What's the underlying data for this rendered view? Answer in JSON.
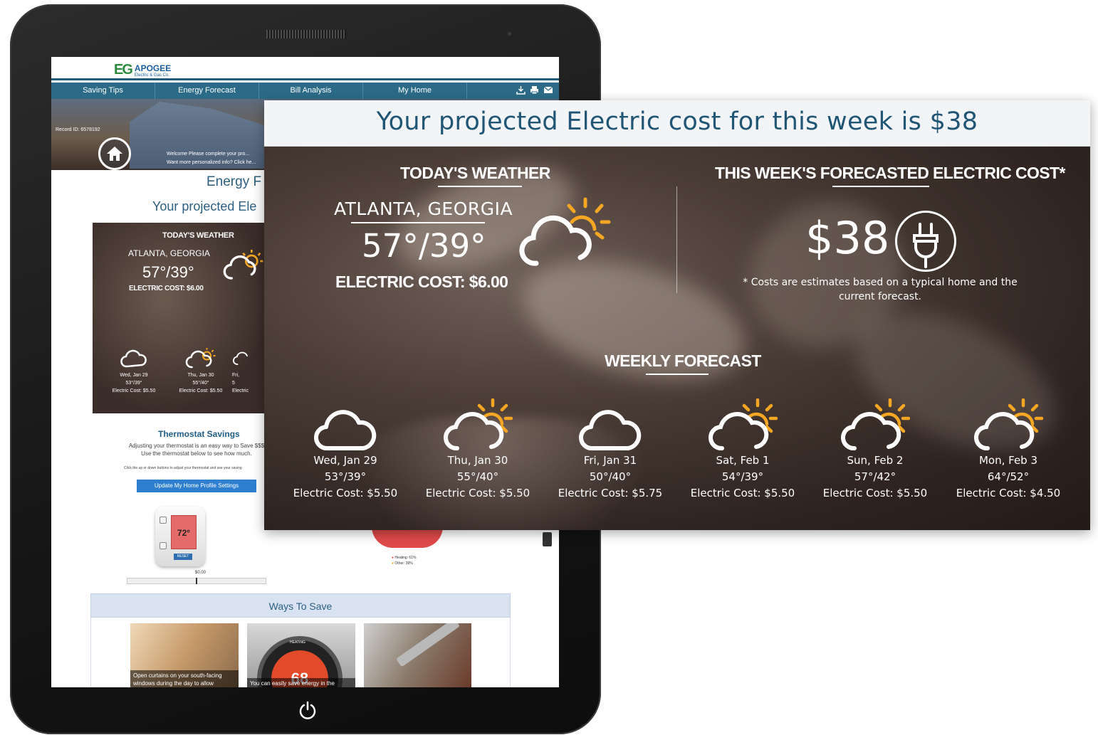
{
  "app": {
    "logo_mark": "EG",
    "logo_name": "APOGEE",
    "logo_sub": "Electric & Gas Co.",
    "nav": [
      "Saving Tips",
      "Energy Forecast",
      "Bill Analysis",
      "My Home"
    ],
    "record_id": "Record ID: 6578192",
    "welcome_line1": "Welcome Please complete your pro...",
    "welcome_line2": "Want more personalized info? Click he...",
    "energy_title": "Energy F",
    "projected_small": "Your projected Ele",
    "mini": {
      "today_heading": "TODAY'S WEATHER",
      "city": "ATLANTA, GEORGIA",
      "temp": "57°/39°",
      "cost": "ELECTRIC COST: $6.00",
      "days": [
        {
          "date": "Wed, Jan 29",
          "temp": "53°/39°",
          "cost": "Electric Cost: $5.50"
        },
        {
          "date": "Thu, Jan 30",
          "temp": "55°/40°",
          "cost": "Electric Cost: $5.50"
        },
        {
          "date": "Fri,",
          "temp": "5",
          "cost": "Electric"
        }
      ]
    },
    "thermostat": {
      "title": "Thermostat Savings",
      "text1": "Adjusting your thermostat is an easy way to Save $$$",
      "text2": "Use the thermostat below to see how much.",
      "hint": "Click the up or down buttons to adjust your thermostat and see your saving",
      "update_button": "Update My Home Profile Settings",
      "setpoint": "72°",
      "reset": "RESET",
      "savings": "$0.00"
    },
    "legend": [
      "Heating: 61%",
      "Other: 39%"
    ],
    "ways_title": "Ways To Save",
    "tiles": [
      {
        "caption": "Open curtains on your south-facing windows during the day to allow"
      },
      {
        "caption": "You can easily save energy in the",
        "dial": "68",
        "dial_label": "HEATING"
      },
      {
        "caption": ""
      }
    ]
  },
  "overlay": {
    "title": "Your projected Electric cost for this week is $38",
    "today_heading": "TODAY'S WEATHER",
    "city": "ATLANTA, GEORGIA",
    "temp": "57°/39°",
    "today_cost": "ELECTRIC COST: $6.00",
    "week_heading": "THIS WEEK'S FORECASTED ELECTRIC COST*",
    "week_cost": "$38",
    "note": "* Costs are estimates based on a typical home and the current forecast.",
    "forecast_heading": "WEEKLY FORECAST",
    "days": [
      {
        "date": "Wed, Jan 29",
        "temp": "53°/39°",
        "cost": "Electric Cost: $5.50",
        "icon": "cloud-icon"
      },
      {
        "date": "Thu, Jan 30",
        "temp": "55°/40°",
        "cost": "Electric Cost: $5.50",
        "icon": "partly-sunny-icon"
      },
      {
        "date": "Fri, Jan 31",
        "temp": "50°/40°",
        "cost": "Electric Cost: $5.75",
        "icon": "cloud-icon"
      },
      {
        "date": "Sat, Feb 1",
        "temp": "54°/39°",
        "cost": "Electric Cost: $5.50",
        "icon": "partly-sunny-icon"
      },
      {
        "date": "Sun, Feb 2",
        "temp": "57°/42°",
        "cost": "Electric Cost: $5.50",
        "icon": "partly-sunny-icon"
      },
      {
        "date": "Mon, Feb 3",
        "temp": "64°/52°",
        "cost": "Electric Cost: $4.50",
        "icon": "partly-sunny-icon"
      }
    ]
  },
  "colors": {
    "title_blue": "#1f5575",
    "nav_teal": "#2c6b88",
    "sun_orange": "#f5a623"
  }
}
